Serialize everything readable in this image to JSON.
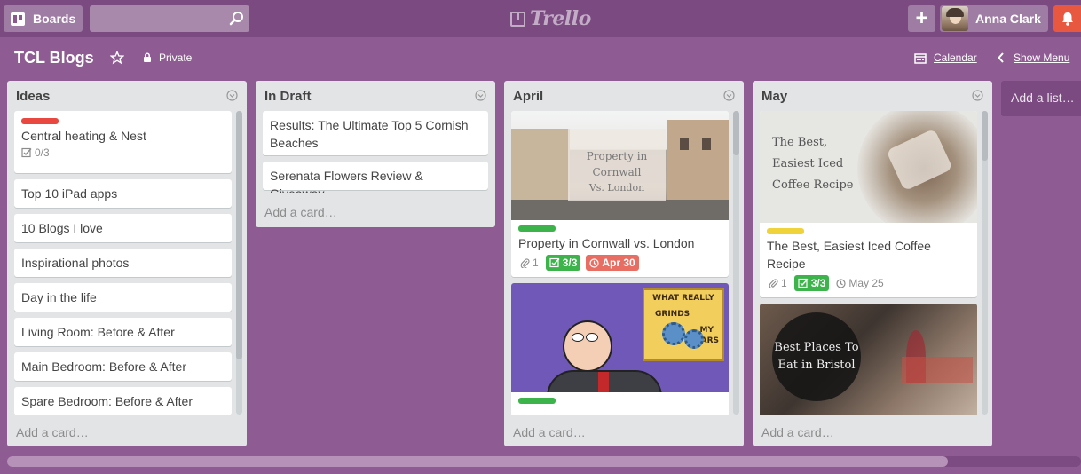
{
  "header": {
    "boards_label": "Boards",
    "search_value": "",
    "logo_text": "Trello",
    "user_name": "Anna Clark"
  },
  "board": {
    "title": "TCL Blogs",
    "visibility": "Private",
    "calendar_label": "Calendar",
    "show_menu_label": "Show Menu"
  },
  "lists": [
    {
      "title": "Ideas",
      "add_card": "Add a card…",
      "cards": [
        {
          "title": "Central heating & Nest",
          "label_color": "#e8483f",
          "checklist": "0/3"
        },
        {
          "title": "Top 10 iPad apps"
        },
        {
          "title": "10 Blogs I love"
        },
        {
          "title": "Inspirational photos"
        },
        {
          "title": "Day in the life"
        },
        {
          "title": "Living Room: Before & After"
        },
        {
          "title": "Main Bedroom: Before & After"
        },
        {
          "title": "Spare Bedroom: Before & After"
        }
      ]
    },
    {
      "title": "In Draft",
      "add_card": "Add a card…",
      "cards": [
        {
          "title": "Results: The Ultimate Top 5 Cornish Beaches"
        },
        {
          "title": "Serenata Flowers Review & Giveaway"
        }
      ]
    },
    {
      "title": "April",
      "add_card": "Add a card…",
      "cards": [
        {
          "cover_text_1": "Property in Cornwall",
          "cover_text_2": "Vs. London",
          "title": "Property in Cornwall vs. London",
          "label_color": "#3cb34b",
          "attachments": "1",
          "checklist": "3/3",
          "due": "Apr 30"
        },
        {
          "cover_caption_1": "WHAT REALLY",
          "cover_caption_2": "GRINDS",
          "cover_caption_3": "MY",
          "cover_caption_4": "GEARS",
          "label_color": "#3cb34b"
        }
      ]
    },
    {
      "title": "May",
      "add_card": "Add a card…",
      "cards": [
        {
          "cover_text_1": "The Best,",
          "cover_text_2": "Easiest Iced",
          "cover_text_3": "Coffee Recipe",
          "title": "The Best, Easiest Iced Coffee Recipe",
          "label_color": "#f0d33a",
          "attachments": "1",
          "checklist": "3/3",
          "due": "May 25"
        },
        {
          "cover_text_1": "Best Places To",
          "cover_text_2": "Eat in Bristol"
        }
      ]
    }
  ],
  "add_list_label": "Add a list…",
  "colors": {
    "board_bg": "#8f5b93",
    "header_bg": "#7a4a80",
    "list_bg": "#e2e4e6",
    "notification": "#e8573f",
    "checklist_done": "#3cb34b",
    "due_overdue": "#e86e63"
  },
  "icons": [
    "boards-icon",
    "search-icon",
    "logo-icon",
    "plus-icon",
    "bell-icon",
    "star-icon",
    "lock-icon",
    "calendar-icon",
    "chevron-left-icon",
    "list-menu-icon",
    "checklist-icon",
    "attachment-icon",
    "clock-icon"
  ]
}
